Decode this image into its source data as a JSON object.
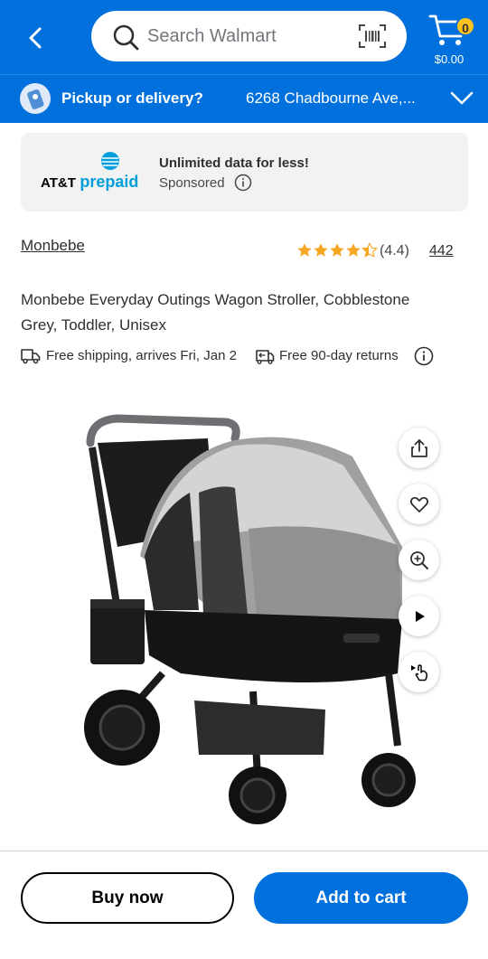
{
  "header": {
    "search_placeholder": "Search Walmart",
    "cart_count": "0",
    "cart_amount": "$0.00"
  },
  "pickup": {
    "title": "Pickup or delivery?",
    "address": "6268 Chadbourne Ave,..."
  },
  "ad": {
    "brand_att": "AT&T",
    "brand_prepaid": "prepaid",
    "headline": "Unlimited data for less!",
    "sponsored": "Sponsored"
  },
  "product": {
    "brand": "Monbebe",
    "rating_text": "(4.4)",
    "rating": 4.4,
    "reviews": "442",
    "title": "Monbebe Everyday Outings Wagon Stroller, Cobblestone Grey, Toddler, Unisex",
    "shipping": "Free shipping, arrives Fri, Jan 2",
    "returns": "Free 90-day returns"
  },
  "actions": {
    "buy_now": "Buy now",
    "add_to_cart": "Add to cart"
  },
  "colors": {
    "brand_blue": "#0071dc",
    "star_yellow": "#f5a623",
    "badge_yellow": "#ffc220"
  },
  "icons": [
    "back-arrow-icon",
    "search-icon",
    "barcode-scan-icon",
    "cart-icon",
    "location-pin-icon",
    "chevron-down-icon",
    "info-icon",
    "truck-icon",
    "returns-icon",
    "share-icon",
    "heart-icon",
    "zoom-icon",
    "play-icon",
    "view-360-icon"
  ]
}
